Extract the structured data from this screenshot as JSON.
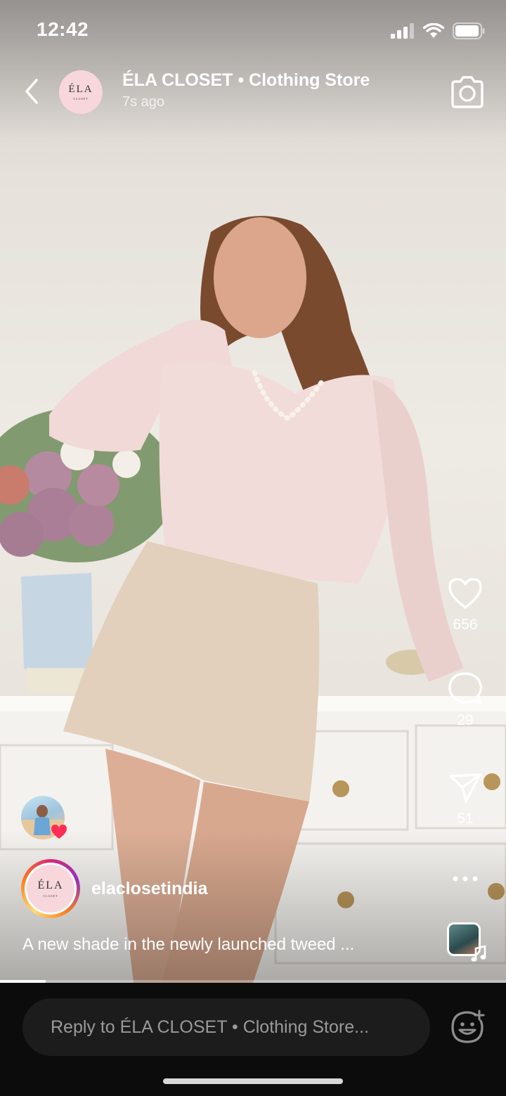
{
  "status_bar": {
    "time": "12:42",
    "icons": [
      "signal-icon",
      "wifi-icon",
      "battery-icon"
    ]
  },
  "story": {
    "account_display_name": "ÉLA CLOSET • Clothing Store",
    "posted_ago": "7s ago",
    "logo_text": "ÉLA",
    "logo_subtext": "CLOSET",
    "progress_fraction": 0.09
  },
  "actions": {
    "likes": "656",
    "comments": "29",
    "shares": "51"
  },
  "author": {
    "username": "elaclosetindia",
    "caption": "A new shade in the newly launched tweed ..."
  },
  "reply": {
    "placeholder": "Reply to ÉLA CLOSET • Clothing Store..."
  },
  "colors": {
    "like_badge": "#ff2e55",
    "reply_bar": "#0c0c0c",
    "avatar_bg": "#f7d7dc"
  }
}
